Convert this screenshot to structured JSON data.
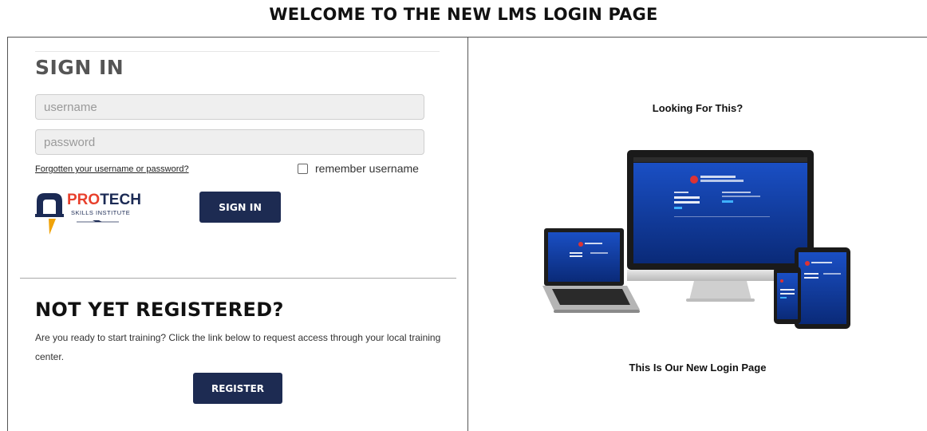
{
  "page": {
    "title": "WELCOME TO THE NEW LMS LOGIN PAGE"
  },
  "signin": {
    "heading": "SIGN IN",
    "username_placeholder": "username",
    "password_placeholder": "password",
    "forgot_link": "Forgotten your username or password?",
    "remember_label": "remember username",
    "submit_label": "SIGN IN"
  },
  "logo": {
    "pro": "PRO",
    "tech": "TECH",
    "subtitle": "SKILLS INSTITUTE"
  },
  "register": {
    "heading": "NOT YET REGISTERED?",
    "description": "Are you ready to start training? Click the link below to request access through your local training center.",
    "button_label": "REGISTER"
  },
  "promo": {
    "heading": "Looking For This?",
    "caption": "This Is Our New Login Page"
  },
  "colors": {
    "button": "#1d2b52",
    "logo_red": "#e8402c",
    "logo_navy": "#1b2a54",
    "screen_blue": "#0d3d9e"
  }
}
